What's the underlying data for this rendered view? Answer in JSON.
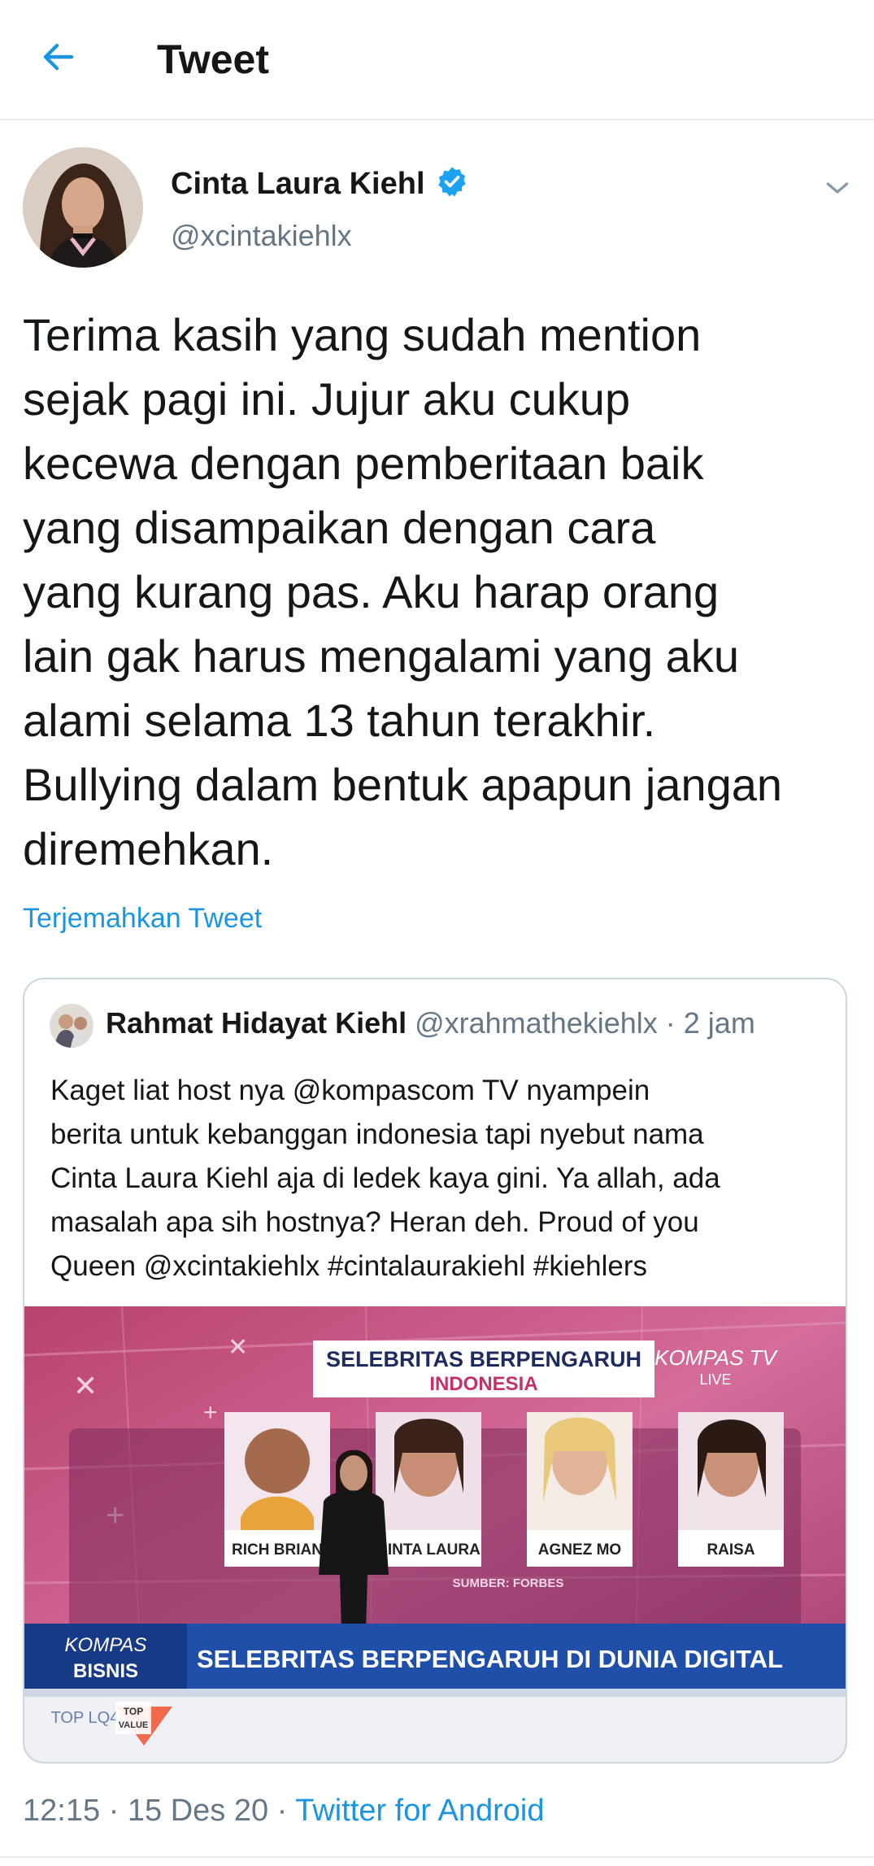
{
  "header": {
    "title": "Tweet"
  },
  "author": {
    "name": "Cinta Laura Kiehl",
    "handle": "@xcintakiehlx"
  },
  "tweet": {
    "lines": [
      "Terima kasih yang sudah mention",
      "sejak pagi ini. Jujur aku cukup",
      "kecewa dengan pemberitaan baik",
      "yang disampaikan dengan cara",
      "yang kurang pas. Aku harap orang",
      "lain gak harus mengalami yang aku",
      "alami selama 13 tahun terakhir.",
      "Bullying dalam bentuk apapun jangan",
      "diremehkan."
    ],
    "translate_label": "Terjemahkan Tweet"
  },
  "quoted": {
    "name": "Rahmat Hidayat Kiehl",
    "handle": "@xrahmathekiehlx",
    "time": "· 2 jam",
    "lines": [
      "Kaget liat host nya @kompascom TV nyampein",
      "berita untuk kebanggan indonesia tapi nyebut nama",
      "Cinta Laura Kiehl aja di ledek kaya gini. Ya allah, ada",
      "masalah apa sih hostnya? Heran deh. Proud of you",
      "Queen @xcintakiehlx #cintalaurakiehl #kiehlers"
    ],
    "media": {
      "headline_top": "SELEBRITAS BERPENGARUH",
      "headline_sub": "INDONESIA",
      "channel": "KOMPAS TV",
      "live": "LIVE",
      "cards": [
        "RICH BRIAN",
        "CINTA LAURA",
        "AGNEZ MO",
        "RAISA"
      ],
      "source": "SUMBER: FORBES",
      "brand_top": "KOMPAS",
      "brand_bottom": "BISNIS",
      "ticker": "SELEBRITAS BERPENGARUH DI DUNIA DIGITAL",
      "badge_top": "TOP",
      "badge_bottom": "VALUE",
      "corner_logo": "TOP LQ45"
    }
  },
  "meta": {
    "time": "12:15",
    "date": "15 Des 20",
    "source": "Twitter for Android"
  },
  "colors": {
    "accent": "#1b95e0",
    "secondary_text": "#657786",
    "ticker_blue": "#1f4fa8",
    "studio_pink": "#c2477e"
  }
}
